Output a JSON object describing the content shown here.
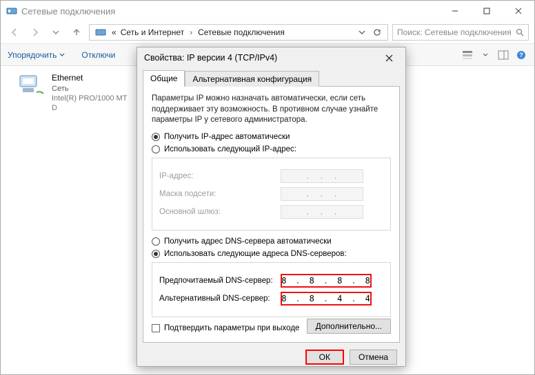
{
  "window": {
    "title": "Сетевые подключения"
  },
  "breadcrumb": {
    "prefix": "«",
    "seg1": "Сеть и Интернет",
    "seg2": "Сетевые подключения"
  },
  "search": {
    "placeholder": "Поиск: Сетевые подключения"
  },
  "toolbar": {
    "organize": "Упорядочить",
    "disable": "Отключи"
  },
  "ethernet": {
    "name": "Ethernet",
    "group": "Сеть",
    "adapter": "Intel(R) PRO/1000 MT D"
  },
  "dialog": {
    "title": "Свойства: IP версии 4 (TCP/IPv4)",
    "tabs": {
      "general": "Общие",
      "alt": "Альтернативная конфигурация"
    },
    "description": "Параметры IP можно назначать автоматически, если сеть поддерживает эту возможность. В противном случае узнайте параметры IP у сетевого администратора.",
    "ip": {
      "auto": "Получить IP-адрес автоматически",
      "manual": "Использовать следующий IP-адрес:",
      "addr": "IP-адрес:",
      "mask": "Маска подсети:",
      "gw": "Основной шлюз:"
    },
    "dns": {
      "auto": "Получить адрес DNS-сервера автоматически",
      "manual": "Использовать следующие адреса DNS-серверов:",
      "pref_lbl": "Предпочитаемый DNS-сервер:",
      "alt_lbl": "Альтернативный DNS-сервер:",
      "pref": [
        "8",
        "8",
        "8",
        "8"
      ],
      "alt": [
        "8",
        "8",
        "4",
        "4"
      ]
    },
    "confirm_exit": "Подтвердить параметры при выходе",
    "advanced": "Дополнительно...",
    "ok": "ОК",
    "cancel": "Отмена"
  }
}
